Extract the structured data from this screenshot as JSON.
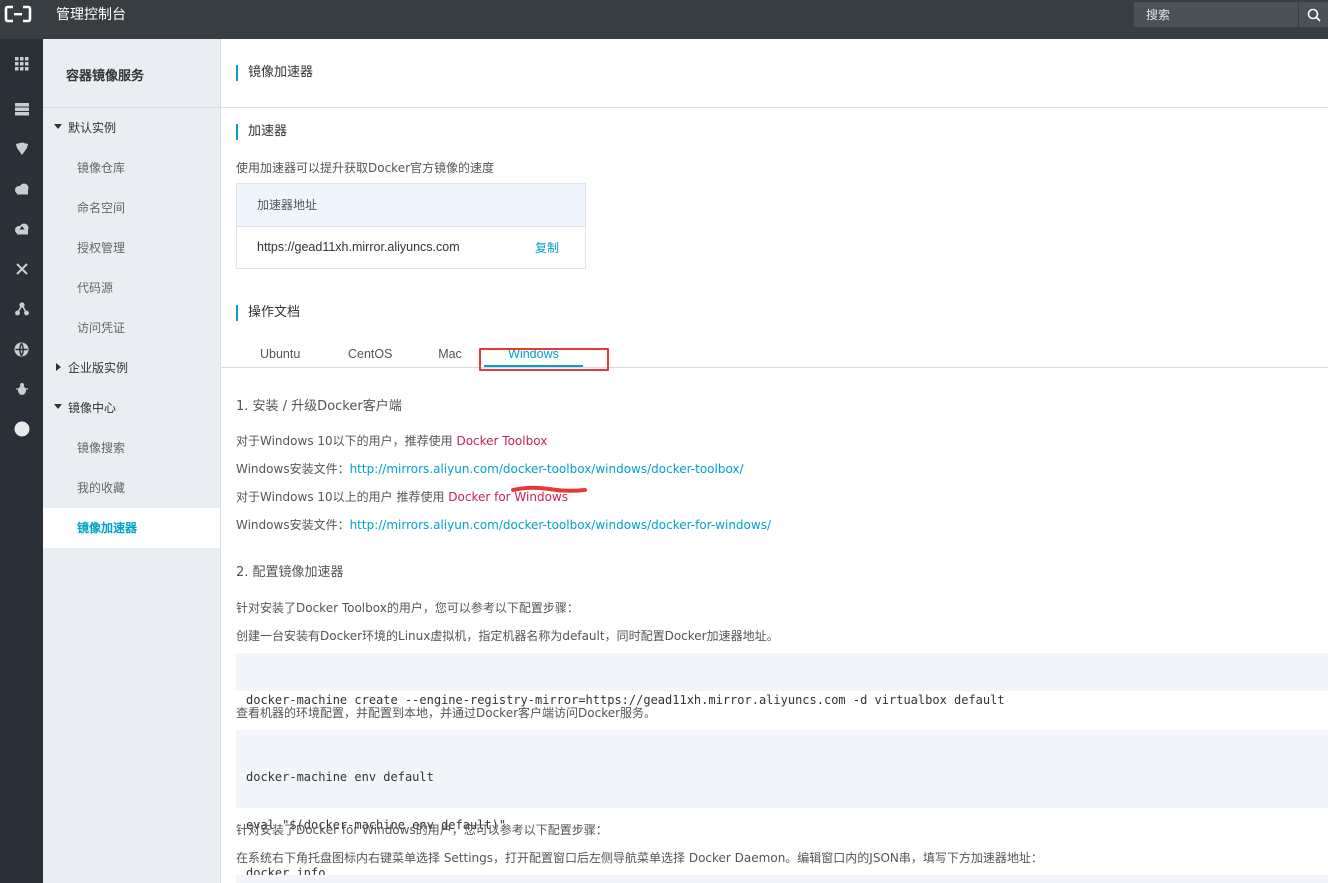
{
  "topbar": {
    "logo_icon": "aliyun-logo-icon",
    "brand": "管理控制台",
    "search_placeholder": "搜索",
    "search_icon": "search-icon",
    "bg_color": "#373d41"
  },
  "rail": {
    "icons": [
      "grid-icon",
      "server-icon",
      "shield-icon",
      "cloud-icon",
      "cloud-upload-icon",
      "network-icon",
      "nodes-icon",
      "globe-icon",
      "bug-icon",
      "circle-icon"
    ]
  },
  "sidebar": {
    "title": "容器镜像服务",
    "groups": [
      {
        "label": "默认实例",
        "expanded": true,
        "items": [
          "镜像仓库",
          "命名空间",
          "授权管理",
          "代码源",
          "访问凭证"
        ]
      },
      {
        "label": "企业版实例",
        "expanded": false,
        "items": []
      },
      {
        "label": "镜像中心",
        "expanded": true,
        "items": [
          "镜像搜索",
          "我的收藏",
          "镜像加速器"
        ]
      }
    ],
    "active_item": "镜像加速器"
  },
  "page": {
    "title": "镜像加速器",
    "accelerator": {
      "section_title": "加速器",
      "description": "使用加速器可以提升获取Docker官方镜像的速度",
      "box_header": "加速器地址",
      "url": "https://gead11xh.mirror.aliyuncs.com",
      "copy_label": "复制"
    },
    "docs": {
      "section_title": "操作文档",
      "tabs": [
        "Ubuntu",
        "CentOS",
        "Mac",
        "Windows"
      ],
      "active_tab": "Windows",
      "step1": {
        "title": "1. 安装 / 升级Docker客户端",
        "line1_prefix": "对于Windows 10以下的用户，推荐使用 ",
        "line1_link": "Docker Toolbox",
        "line2_prefix": "Windows安装文件：",
        "line2_link": "http://mirrors.aliyun.com/docker-toolbox/windows/docker-toolbox/",
        "line3_prefix": "对于Windows 10以上的用户 推荐使用 ",
        "line3_link": "Docker for Windows",
        "line4_prefix": "Windows安装文件：",
        "line4_link": "http://mirrors.aliyun.com/docker-toolbox/windows/docker-for-windows/"
      },
      "step2": {
        "title": "2. 配置镜像加速器",
        "p1": "针对安装了Docker Toolbox的用户，您可以参考以下配置步骤：",
        "p2": "创建一台安装有Docker环境的Linux虚拟机，指定机器名称为default，同时配置Docker加速器地址。",
        "code1": "docker-machine create --engine-registry-mirror=https://gead11xh.mirror.aliyuncs.com -d virtualbox default",
        "p3": "查看机器的环境配置，并配置到本地，并通过Docker客户端访问Docker服务。",
        "code2": [
          "docker-machine env default",
          "eval \"$(docker-machine env default)\"",
          "docker info"
        ],
        "p4": "针对安装了Docker for Windows的用户，您可以参考以下配置步骤：",
        "p5": "在系统右下角托盘图标内右键菜单选择 Settings，打开配置窗口后左侧导航菜单选择 Docker Daemon。编辑窗口内的JSON串，填写下方加速器地址："
      }
    }
  }
}
